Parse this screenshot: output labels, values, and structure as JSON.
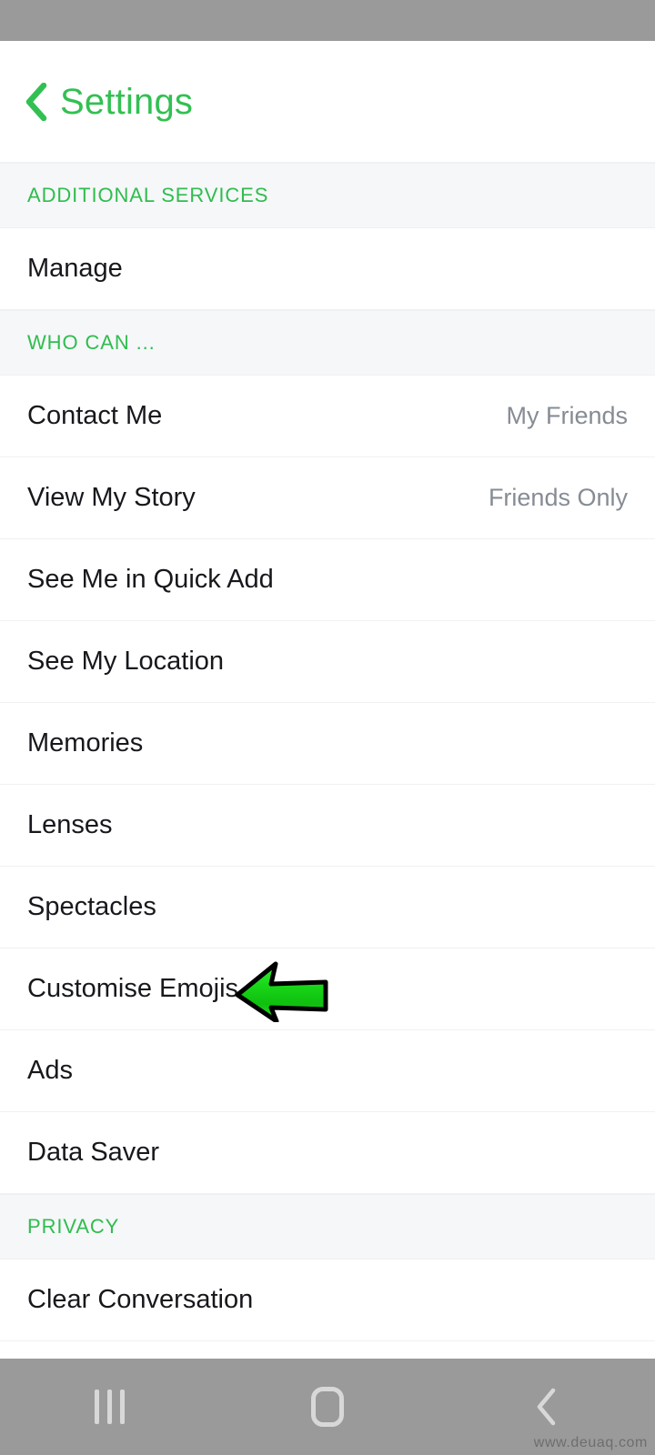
{
  "header": {
    "title": "Settings",
    "back_icon": "chevron-left-icon",
    "accent_color": "#32c052"
  },
  "sections": [
    {
      "title": "ADDITIONAL SERVICES",
      "rows": [
        {
          "label": "Manage",
          "value": ""
        }
      ]
    },
    {
      "title": "WHO CAN ...",
      "rows": [
        {
          "label": "Contact Me",
          "value": "My Friends"
        },
        {
          "label": "View My Story",
          "value": "Friends Only"
        },
        {
          "label": "See Me in Quick Add",
          "value": ""
        },
        {
          "label": "See My Location",
          "value": ""
        },
        {
          "label": "Memories",
          "value": ""
        },
        {
          "label": "Lenses",
          "value": ""
        },
        {
          "label": "Spectacles",
          "value": ""
        },
        {
          "label": "Customise Emojis",
          "value": ""
        },
        {
          "label": "Ads",
          "value": ""
        },
        {
          "label": "Data Saver",
          "value": ""
        }
      ]
    },
    {
      "title": "PRIVACY",
      "rows": [
        {
          "label": "Clear Conversation",
          "value": ""
        }
      ]
    }
  ],
  "annotation": {
    "shape": "arrow-left-icon",
    "points_to": "Customise Emojis",
    "fill_color": "#22dd22",
    "stroke_color": "#000000"
  },
  "android_nav": {
    "recents_label": "recents-icon",
    "home_label": "home-icon",
    "back_label": "back-icon",
    "watermark": "www.deuaq.com"
  },
  "colors": {
    "accent_green": "#2fbd4e",
    "section_bg": "#f6f7f9",
    "row_bg": "#ffffff",
    "label_text": "#16181c",
    "value_text": "#868c94",
    "system_bar": "#9a9a9a"
  }
}
